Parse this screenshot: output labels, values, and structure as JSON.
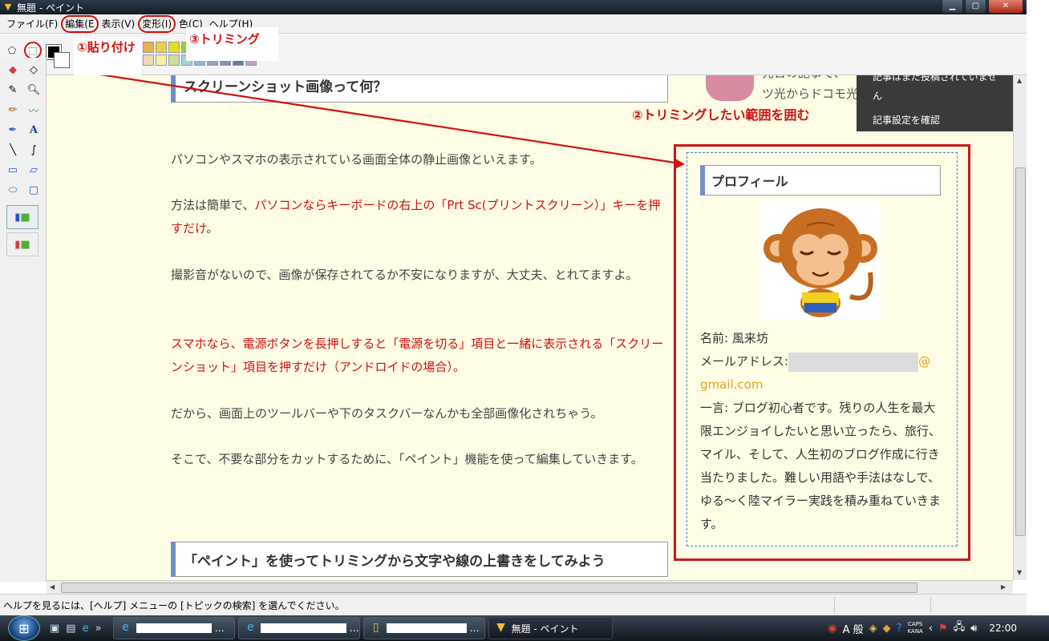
{
  "window": {
    "title": "無題 - ペイント",
    "controls": {
      "minimize": "▁",
      "maximize": "▢",
      "close": "✕"
    }
  },
  "menu": [
    {
      "label": "ファイル(F)",
      "circled": false
    },
    {
      "label": "編集(E",
      "circled": true
    },
    {
      "label": "表示(V)",
      "circled": false
    },
    {
      "label": "変形(I)",
      "circled": true
    },
    {
      "label": "色(C)",
      "circled": false
    },
    {
      "label": "ヘルプ(H)",
      "circled": false
    }
  ],
  "annotations": {
    "paste": "①貼り付け",
    "trim_select": "②トリミングしたい範囲を囲む",
    "trim": "③トリミング"
  },
  "palette_colors": [
    "#e8b050",
    "#f0d040",
    "#e0e020",
    "#90d040",
    "#ffffff",
    "#ffffff",
    "#ffffff",
    "#ffffff",
    "#ffffff",
    "#f0d8b0",
    "#f8f0a0",
    "#c8e0a0",
    "#a8d0d8",
    "#88b8e0",
    "#90a0c0",
    "#8090b8",
    "#6878a8",
    "#c0a0c8"
  ],
  "article": {
    "heading_top": "スクリーンショット画像って何？",
    "teaser_line1": "先日の記事で、",
    "teaser_line2": "ツ光からドコモ光に回線を変",
    "popup_line1": "記事はまだ投稿されていません",
    "popup_line2": "記事設定を確認",
    "p1": "パソコンやスマホの表示されている画面全体の静止画像といえます。",
    "p2_lead": "方法は簡単で、",
    "p2_red": "パソコンならキーボードの右上の「Prt Sc(プリントスクリーン）」キーを押すだけ",
    "p2_end": "。",
    "p3": "撮影音がないので、画像が保存されてるか不安になりますが、大丈夫、とれてますよ。",
    "p4": "スマホなら、電源ボタンを長押しすると「電源を切る」項目と一緒に表示される「スクリーンショット」項目を押すだけ（アンドロイドの場合）。",
    "p5": "だから、画面上のツールバーや下のタスクバーなんかも全部画像化されちゃう。",
    "p6": "そこで、不要な部分をカットするために、「ペイント」機能を使って編集していきます。",
    "heading_bottom": "「ペイント」を使ってトリミングから文字や線の上書きをしてみよう"
  },
  "profile": {
    "title": "プロフィール",
    "name": "名前: 風来坊",
    "email_label": "メールアドレス:",
    "email_at": "@",
    "email_domain": "gmail.com",
    "bio": "一言: ブログ初心者です。残りの人生を最大限エンジョイしたいと思い立ったら、旅行、マイル、そして、人生初のブログ作成に行き当たりました。難しい用語や手法はなしで、ゆる～く陸マイラー実践を積み重ねていきます。"
  },
  "statusbar": {
    "text": "ヘルプを見るには、[ヘルプ] メニューの [トピックの検索] を選んでください。"
  },
  "taskbar": {
    "active_task": "無題 - ペイント",
    "ime": "A 般",
    "caps": "CAPS",
    "kana": "KANA",
    "clock": "22:00"
  },
  "colors": {
    "canvas_bg": "#fffde5",
    "annotation_red": "#d01010",
    "heading_accent": "#6f8fc8",
    "link_orange": "#e8a020"
  }
}
